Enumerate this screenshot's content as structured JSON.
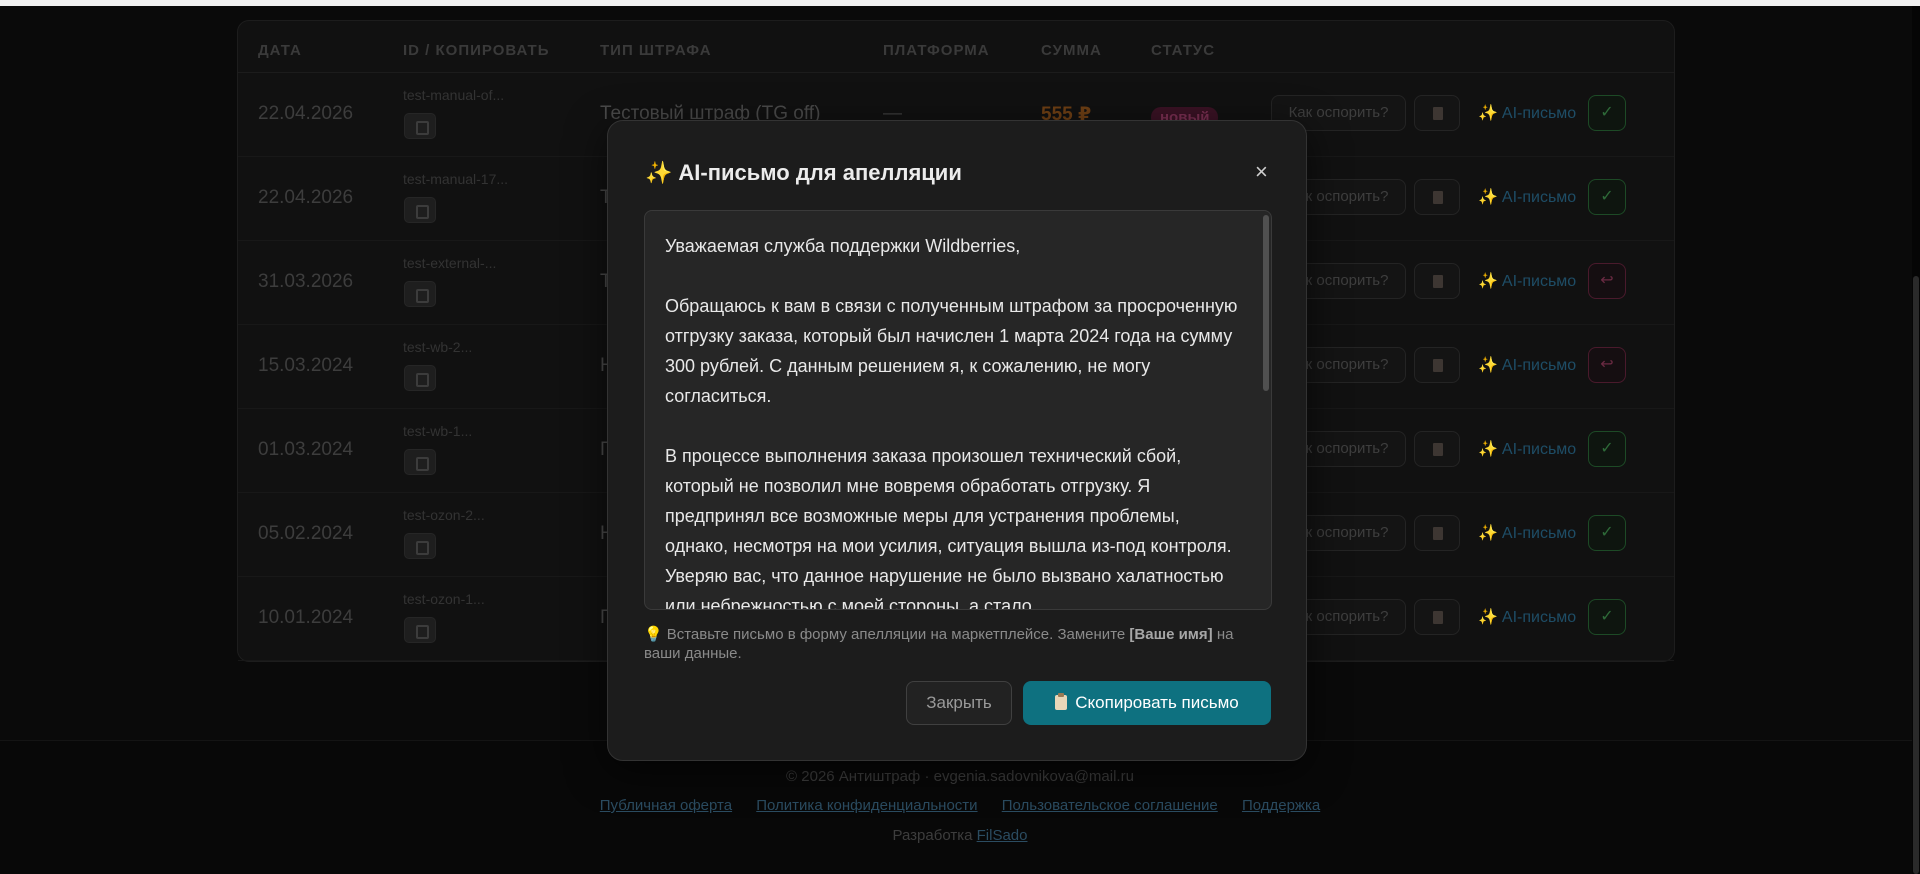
{
  "table": {
    "headers": [
      "ДАТА",
      "ID / КОПИРОВАТЬ",
      "ТИП ШТРАФА",
      "ПЛАТФОРМА",
      "СУММА",
      "СТАТУС"
    ],
    "rows": [
      {
        "date": "22.04.2026",
        "id": "test-manual-of...",
        "type": "Тестовый штраф (TG off)",
        "platform": "—",
        "sum": "555 ₽",
        "status": "новый",
        "action": "ok"
      },
      {
        "date": "22.04.2026",
        "id": "test-manual-17...",
        "type": "Т",
        "platform": "",
        "sum": "",
        "status": "",
        "action": "ok"
      },
      {
        "date": "31.03.2026",
        "id": "test-external-...",
        "type": "Т",
        "platform": "",
        "sum": "",
        "status": "",
        "action": "back"
      },
      {
        "date": "15.03.2024",
        "id": "test-wb-2...",
        "type": "Н",
        "platform": "",
        "sum": "",
        "status": "",
        "action": "back"
      },
      {
        "date": "01.03.2024",
        "id": "test-wb-1...",
        "type": "П",
        "platform": "",
        "sum": "",
        "status": "",
        "action": "ok"
      },
      {
        "date": "05.02.2024",
        "id": "test-ozon-2...",
        "type": "Н",
        "platform": "",
        "sum": "",
        "status": "",
        "action": "ok"
      },
      {
        "date": "10.01.2024",
        "id": "test-ozon-1...",
        "type": "П",
        "platform": "",
        "sum": "",
        "status": "",
        "action": "ok"
      }
    ],
    "dispute_label": "Как оспорить?",
    "ai_label": "AI-письмо",
    "ok_glyph": "✓",
    "back_glyph": "↩"
  },
  "footer": {
    "copyright": "© 2026 Антиштраф · evgenia.sadovnikova@mail.ru",
    "links": [
      "Публичная оферта",
      "Политика конфиденциальности",
      "Пользовательское соглашение",
      "Поддержка"
    ],
    "dev_prefix": "Разработка",
    "dev_link": "FilSado"
  },
  "modal": {
    "icon": "✨",
    "title": "AI-письмо для апелляции",
    "close_glyph": "×",
    "letter": "Уважаемая служба поддержки Wildberries,\n\nОбращаюсь к вам в связи с полученным штрафом за просроченную отгрузку заказа, который был начислен 1 марта 2024 года на сумму 300 рублей. С данным решением я, к сожалению, не могу согласиться.\n\nВ процессе выполнения заказа произошел технический сбой, который не позволил мне вовремя обработать отгрузку. Я предпринял все возможные меры для устранения проблемы, однако, несмотря на мои усилия, ситуация вышла из-под контроля. Уверяю вас, что данное нарушение не было вызвано халатностью или небрежностью с моей стороны, а стало",
    "hint_bulb": "💡",
    "hint_before": "Вставьте письмо в форму апелляции на маркетплейсе. Замените ",
    "hint_bold": "[Ваше имя]",
    "hint_after": " на ваши данные.",
    "close_button": "Закрыть",
    "copy_button": "Скопировать письмо"
  },
  "colors": {
    "accent": "#0e7180",
    "modal_bg": "#1c1c1c",
    "page_bg": "#0a0a0a"
  }
}
